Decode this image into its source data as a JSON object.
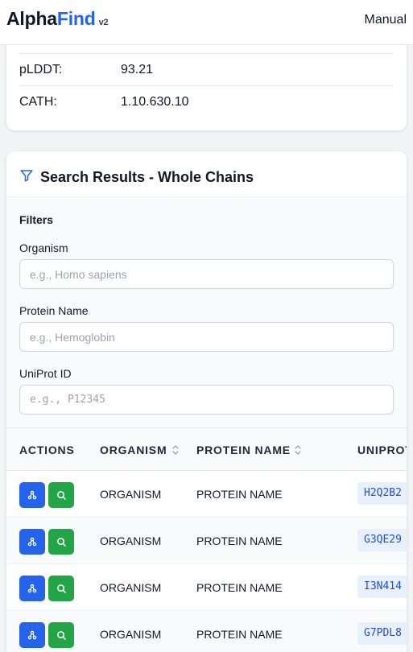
{
  "header": {
    "logo_part1": "Alpha",
    "logo_part2": "Find",
    "logo_version": "v2",
    "nav_manual": "Manual"
  },
  "info": {
    "rows": [
      {
        "label": "pLDDT:",
        "value": "93.21"
      },
      {
        "label": "CATH:",
        "value": "1.10.630.10"
      }
    ]
  },
  "results": {
    "title": "Search Results - Whole Chains",
    "filters": {
      "heading": "Filters",
      "organism_label": "Organism",
      "organism_placeholder": "e.g., Homo sapiens",
      "protein_label": "Protein Name",
      "protein_placeholder": "e.g., Hemoglobin",
      "uniprot_label": "UniProt ID",
      "uniprot_placeholder": "e.g., P12345"
    },
    "table": {
      "columns": [
        "ACTIONS",
        "ORGANISM",
        "PROTEIN NAME",
        "UNIPROT"
      ],
      "rows": [
        {
          "organism": "ORGANISM",
          "protein": "PROTEIN NAME",
          "uniprot": "H2Q2B2"
        },
        {
          "organism": "ORGANISM",
          "protein": "PROTEIN NAME",
          "uniprot": "G3QE29"
        },
        {
          "organism": "ORGANISM",
          "protein": "PROTEIN NAME",
          "uniprot": "I3N414"
        },
        {
          "organism": "ORGANISM",
          "protein": "PROTEIN NAME",
          "uniprot": "G7PDL8"
        }
      ]
    }
  },
  "colors": {
    "accent_blue": "#2563eb",
    "accent_green": "#22a447",
    "chip_bg": "#e8f0fd"
  },
  "icons": {
    "filter": "filter-icon",
    "sort": "sort-icon",
    "structure": "structure-icon",
    "search": "search-icon"
  }
}
